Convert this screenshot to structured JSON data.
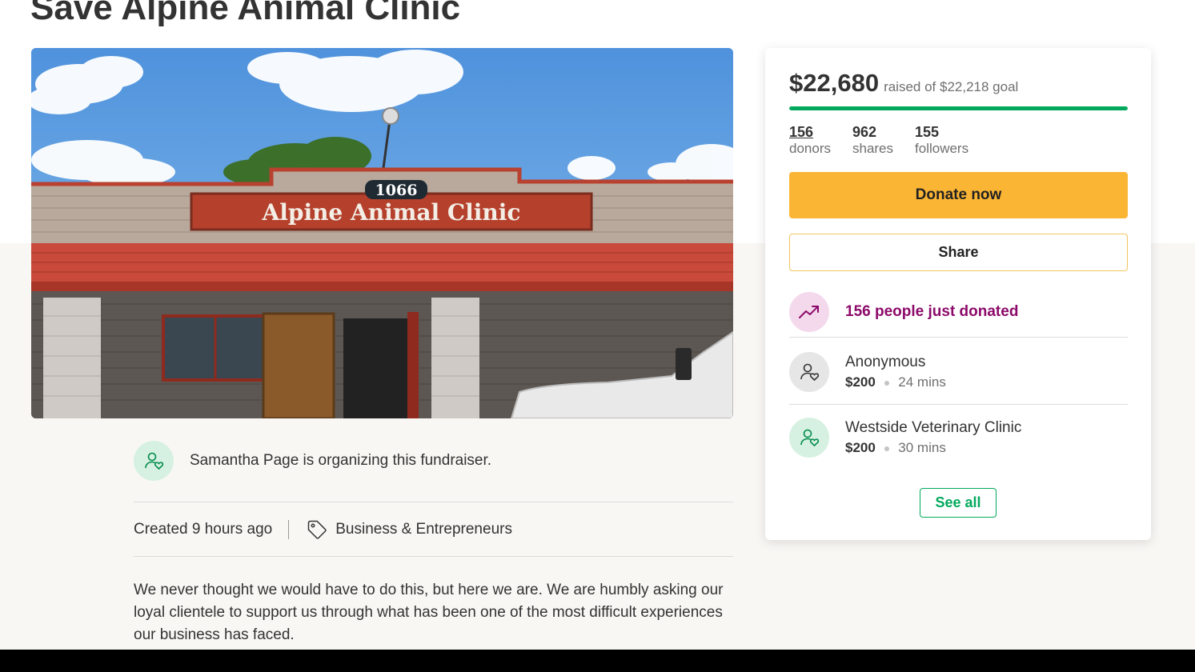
{
  "title": "Save Alpine Animal Clinic",
  "hero": {
    "building_number": "1066",
    "sign_text": "Alpine Animal Clinic"
  },
  "organizer": {
    "text": "Samantha Page is organizing this fundraiser.",
    "icon": "person-heart-icon"
  },
  "meta": {
    "created": "Created 9 hours ago",
    "category": "Business & Entrepreneurs",
    "category_icon": "tag-icon"
  },
  "story": {
    "text": "We never thought we would have to do this, but here we are. We are humbly asking our loyal clientele to support us through what has been one of the most difficult experiences our business has faced."
  },
  "sidebar": {
    "raised_amount": "$22,680",
    "raised_goal": "raised of $22,218 goal",
    "progress_fraction": 1.0,
    "stats": [
      {
        "value": "156",
        "label": "donors"
      },
      {
        "value": "962",
        "label": "shares"
      },
      {
        "value": "155",
        "label": "followers"
      }
    ],
    "donate_label": "Donate now",
    "share_label": "Share",
    "just_donated": "156 people just donated",
    "donations": [
      {
        "name": "Anonymous",
        "amount": "$200",
        "time": "24 mins"
      },
      {
        "name": "Westside Veterinary Clinic",
        "amount": "$200",
        "time": "30 mins"
      }
    ],
    "see_all_label": "See all"
  },
  "colors": {
    "accent_green": "#02a95c",
    "donate_yellow": "#fbb534",
    "trending_purple": "#8c0a6a"
  }
}
